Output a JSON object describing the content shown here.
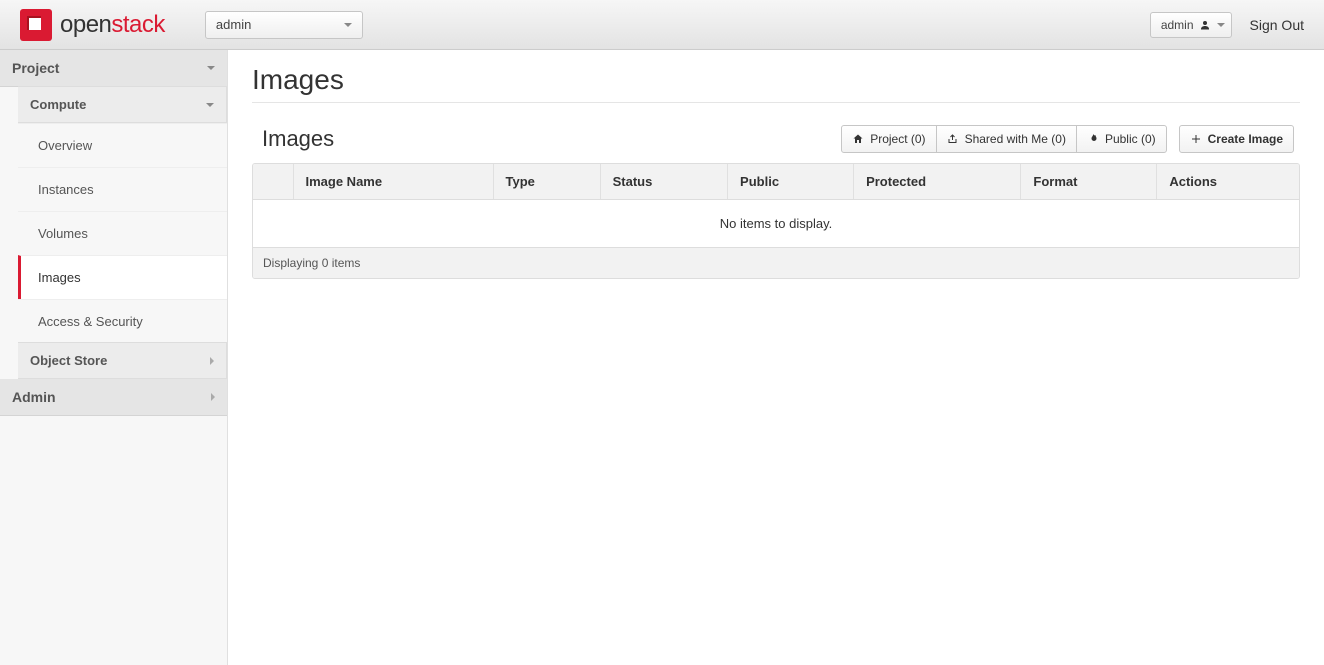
{
  "brand": {
    "name": "openstack"
  },
  "topbar": {
    "tenant": "admin",
    "user": "admin",
    "sign_out": "Sign Out"
  },
  "sidebar": {
    "project": {
      "label": "Project",
      "compute": {
        "label": "Compute",
        "items": [
          {
            "label": "Overview",
            "active": false
          },
          {
            "label": "Instances",
            "active": false
          },
          {
            "label": "Volumes",
            "active": false
          },
          {
            "label": "Images",
            "active": true
          },
          {
            "label": "Access & Security",
            "active": false
          }
        ]
      },
      "object_store": {
        "label": "Object Store"
      }
    },
    "admin": {
      "label": "Admin"
    }
  },
  "page": {
    "title": "Images",
    "section_title": "Images",
    "filters": {
      "project": "Project (0)",
      "shared": "Shared with Me (0)",
      "public": "Public (0)"
    },
    "create_btn": "Create Image",
    "table": {
      "headers": {
        "name": "Image Name",
        "type": "Type",
        "status": "Status",
        "public": "Public",
        "protected": "Protected",
        "format": "Format",
        "actions": "Actions"
      },
      "empty_text": "No items to display.",
      "footer": "Displaying 0 items"
    }
  }
}
